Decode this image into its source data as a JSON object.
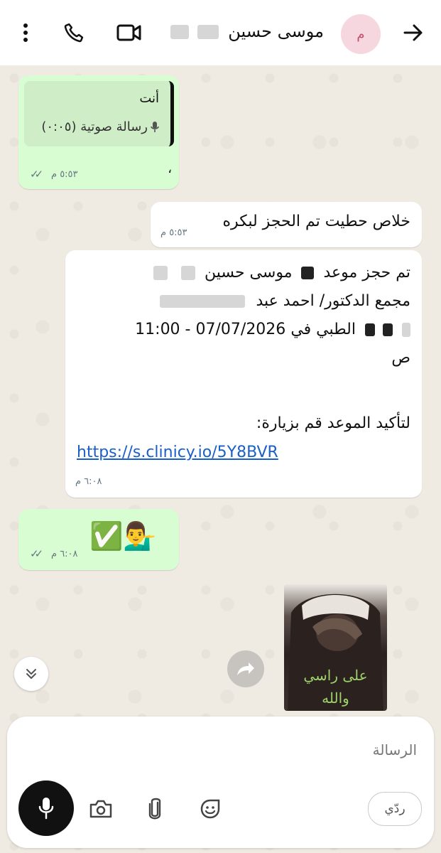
{
  "header": {
    "contact_name": "موسى حسين",
    "avatar_initial": "م"
  },
  "messages": [
    {
      "type": "outgoing-reply",
      "quote_author": "أنت",
      "quote_body": "رسالة صوتية (٠:٠٥)",
      "body": "،",
      "time": "٥:٥٣ م"
    },
    {
      "type": "incoming",
      "body": "خلاص حطيت تم الحجز لبكره",
      "time": "٥:٥٣ م"
    },
    {
      "type": "incoming",
      "lines": [
        "تم حجز موعد",
        "موسى حسين",
        "مجمع الدكتور/ احمد عبد",
        "الطبي في",
        "07/07/2026 - 11:00",
        "ص",
        "لتأكيد الموعد قم بزيارة:"
      ],
      "link": "https://s.clinicy.io/5Y8BVR",
      "time": "٦:٠٨ م"
    },
    {
      "type": "outgoing-emoji",
      "body": "✅💁‍♂️",
      "time": "٦:٠٨ م"
    },
    {
      "type": "sticker",
      "sticker_text_1": "على راسي",
      "sticker_text_2": "والله"
    }
  ],
  "composer": {
    "placeholder": "الرسالة",
    "quick_reply": "ردّي"
  },
  "colors": {
    "outgoing_bubble": "#d9fdd3",
    "incoming_bubble": "#ffffff",
    "chat_background": "#efeae2",
    "link": "#1a5fc8"
  },
  "icons": [
    "back-arrow-icon",
    "video-call-icon",
    "voice-call-icon",
    "more-vert-icon",
    "mic-icon",
    "camera-icon",
    "attach-icon",
    "sticker-icon",
    "forward-icon",
    "scroll-down-icon",
    "double-check-icon"
  ]
}
